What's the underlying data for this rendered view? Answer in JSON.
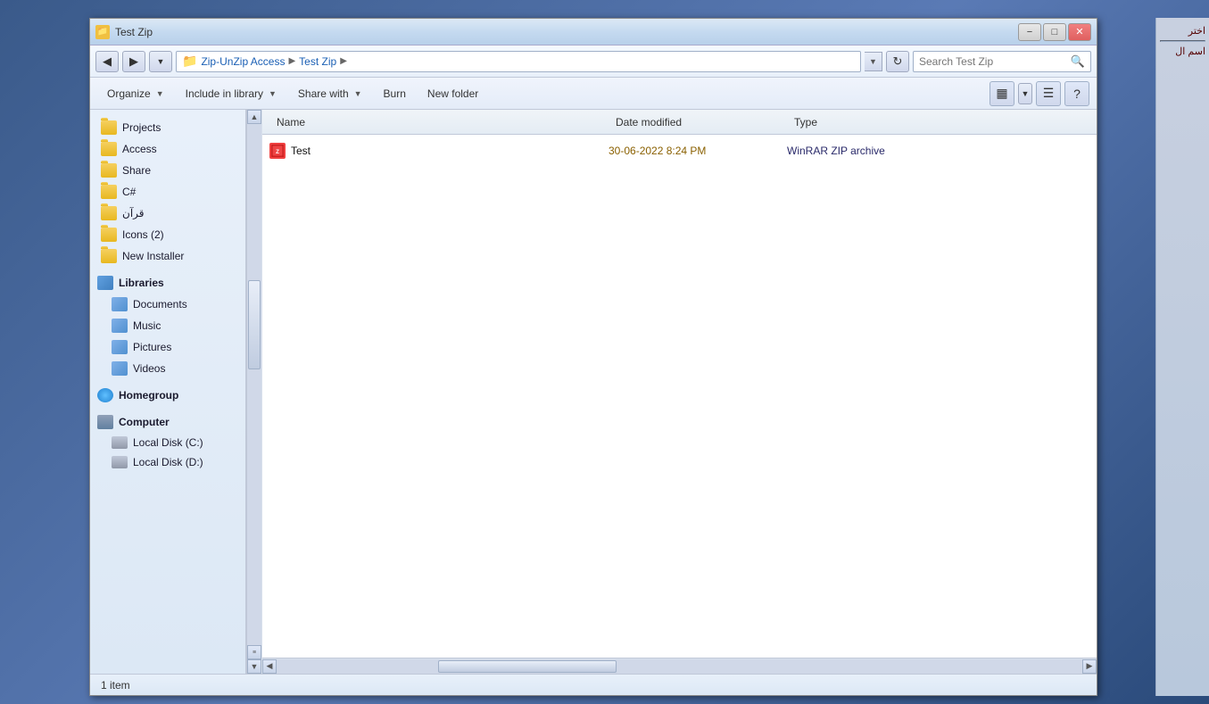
{
  "window": {
    "title": "Test Zip",
    "icon": "📁",
    "minimize_label": "−",
    "maximize_label": "□",
    "close_label": "✕"
  },
  "address_bar": {
    "back_arrow": "◀",
    "forward_arrow": "▶",
    "dropdown_arrow": "▼",
    "path_parts": [
      "Zip-UnZip Access",
      "Test Zip"
    ],
    "separator": "▶",
    "refresh": "↻",
    "search_placeholder": "Search Test Zip",
    "search_icon": "🔍"
  },
  "toolbar": {
    "organize_label": "Organize",
    "include_in_library_label": "Include in library",
    "share_with_label": "Share with",
    "burn_label": "Burn",
    "new_folder_label": "New folder",
    "dropdown_arrow": "▼",
    "view_icon": "▦",
    "details_icon": "≡",
    "help_icon": "?"
  },
  "sidebar": {
    "folders": [
      {
        "label": "Projects"
      },
      {
        "label": "Access"
      },
      {
        "label": "Share"
      },
      {
        "label": "C#"
      },
      {
        "label": "قرآن"
      },
      {
        "label": "Icons (2)"
      },
      {
        "label": "New Installer"
      }
    ],
    "libraries_label": "Libraries",
    "library_items": [
      {
        "label": "Documents"
      },
      {
        "label": "Music"
      },
      {
        "label": "Pictures"
      },
      {
        "label": "Videos"
      }
    ],
    "homegroup_label": "Homegroup",
    "computer_label": "Computer",
    "disks": [
      {
        "label": "Local Disk (C:)"
      },
      {
        "label": "Local Disk (D:)"
      }
    ]
  },
  "file_list": {
    "col_name": "Name",
    "col_date": "Date modified",
    "col_type": "Type",
    "files": [
      {
        "name": "Test",
        "date": "30-06-2022 8:24 PM",
        "type": "WinRAR ZIP archive"
      }
    ]
  },
  "status_bar": {
    "text": "1 item"
  },
  "right_panel": {
    "text1": "اختر",
    "text2": "اسم ال"
  }
}
